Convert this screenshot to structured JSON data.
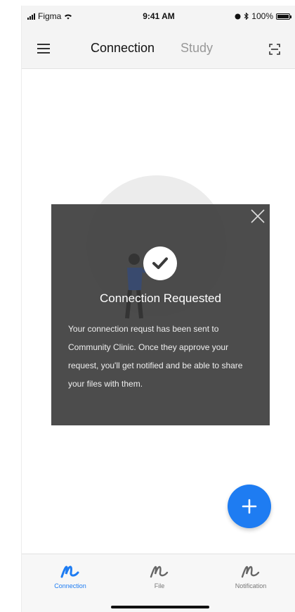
{
  "status_bar": {
    "carrier": "Figma",
    "time": "9:41 AM",
    "battery": "100%",
    "battery_level": 1.0
  },
  "header": {
    "tabs": [
      {
        "label": "Connection",
        "active": true
      },
      {
        "label": "Study",
        "active": false
      }
    ],
    "icons": {
      "menu": "menu-icon",
      "scan": "scan-icon"
    }
  },
  "modal": {
    "title": "Connection Requested",
    "body": "Your connection requst has been sent to Community Clinic. Once they approve your request, you'll get notified and be able to share your files with them.",
    "icons": {
      "close": "close-icon",
      "check": "check-icon"
    }
  },
  "fab": {
    "icon": "plus-icon"
  },
  "bottom_nav": {
    "items": [
      {
        "label": "Connection",
        "icon": "connection-icon",
        "active": true
      },
      {
        "label": "File",
        "icon": "file-icon",
        "active": false
      },
      {
        "label": "Notification",
        "icon": "notification-icon",
        "active": false
      }
    ]
  },
  "colors": {
    "accent": "#1e7cf2",
    "modal_bg": "#3e3e3e",
    "header_bg": "#f4f4f4",
    "inactive_text": "#999999"
  }
}
